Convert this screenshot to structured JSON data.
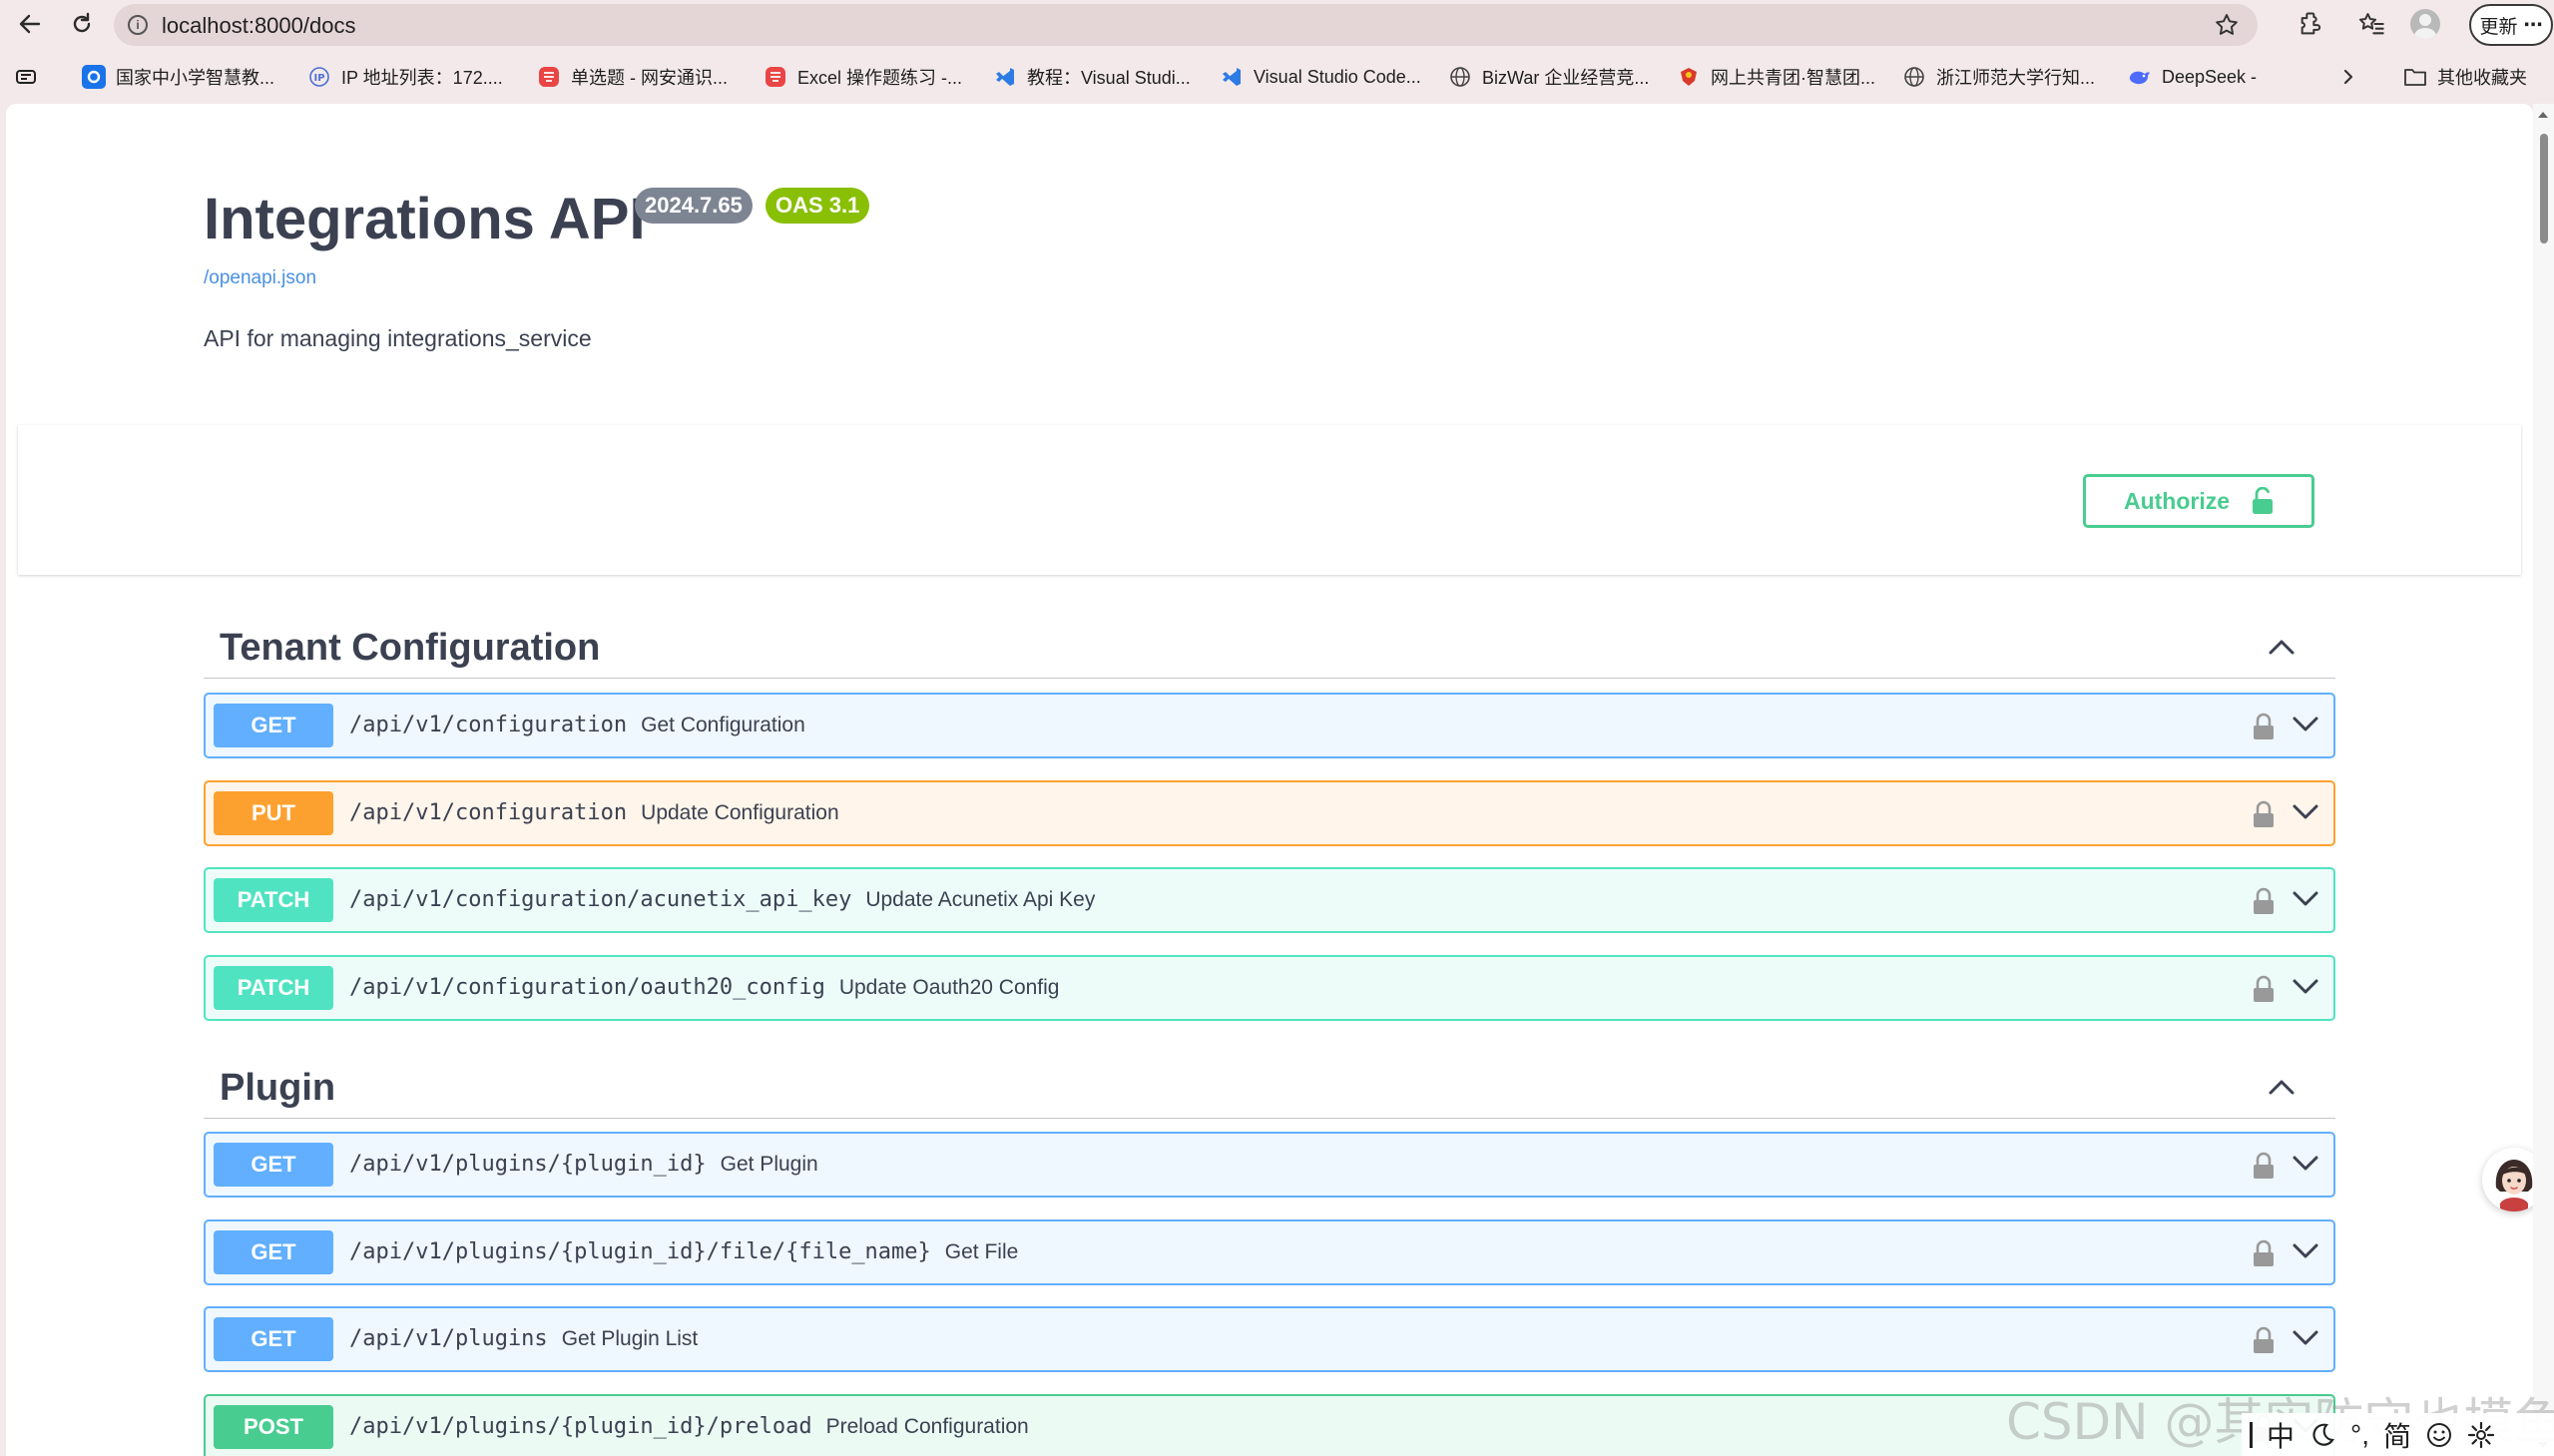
{
  "browser": {
    "url": "localhost:8000/docs",
    "update_label": "更新",
    "more_label": "⋯",
    "bookmarks": [
      {
        "label": "国家中小学智慧教...",
        "icon": "smartedu-icon",
        "color": "#1a73e8"
      },
      {
        "label": "IP 地址列表：172....",
        "icon": "ip-icon",
        "color": "#4a6fd6"
      },
      {
        "label": "单选题 - 网安通识...",
        "icon": "site-icon",
        "color": "#e94545"
      },
      {
        "label": "Excel 操作题练习 -...",
        "icon": "site-icon",
        "color": "#e94545"
      },
      {
        "label": "教程：Visual Studi...",
        "icon": "vscode-icon",
        "color": "#2d7be5"
      },
      {
        "label": "Visual Studio Code...",
        "icon": "vscode-icon",
        "color": "#2d7be5"
      },
      {
        "label": "BizWar 企业经营竞...",
        "icon": "globe-icon",
        "color": "#444444"
      },
      {
        "label": "网上共青团·智慧团...",
        "icon": "cyl-icon",
        "color": "#d93a2b"
      },
      {
        "label": "浙江师范大学行知...",
        "icon": "globe-icon",
        "color": "#444444"
      },
      {
        "label": "DeepSeek -",
        "icon": "deepseek-icon",
        "color": "#4d6bfe"
      }
    ],
    "other_bookmarks": "其他收藏夹"
  },
  "info": {
    "title": "Integrations API",
    "version": "2024.7.65",
    "oas": "OAS 3.1",
    "openapi_link": "/openapi.json",
    "description": "API for managing integrations_service"
  },
  "authorize_label": "Authorize",
  "tags": [
    {
      "name": "Tenant Configuration",
      "operations": [
        {
          "method": "GET",
          "path": "/api/v1/configuration",
          "summary": "Get Configuration"
        },
        {
          "method": "PUT",
          "path": "/api/v1/configuration",
          "summary": "Update Configuration"
        },
        {
          "method": "PATCH",
          "path": "/api/v1/configuration/acunetix_api_key",
          "summary": "Update Acunetix Api Key"
        },
        {
          "method": "PATCH",
          "path": "/api/v1/configuration/oauth20_config",
          "summary": "Update Oauth20 Config"
        }
      ]
    },
    {
      "name": "Plugin",
      "operations": [
        {
          "method": "GET",
          "path": "/api/v1/plugins/{plugin_id}",
          "summary": "Get Plugin"
        },
        {
          "method": "GET",
          "path": "/api/v1/plugins/{plugin_id}/file/{file_name}",
          "summary": "Get File"
        },
        {
          "method": "GET",
          "path": "/api/v1/plugins",
          "summary": "Get Plugin List"
        },
        {
          "method": "POST",
          "path": "/api/v1/plugins/{plugin_id}/preload",
          "summary": "Preload Configuration"
        }
      ]
    }
  ],
  "watermark": "CSDN @其实防守也摸鱼",
  "ime": {
    "mode": "中",
    "punct": "°,",
    "script": "简"
  }
}
